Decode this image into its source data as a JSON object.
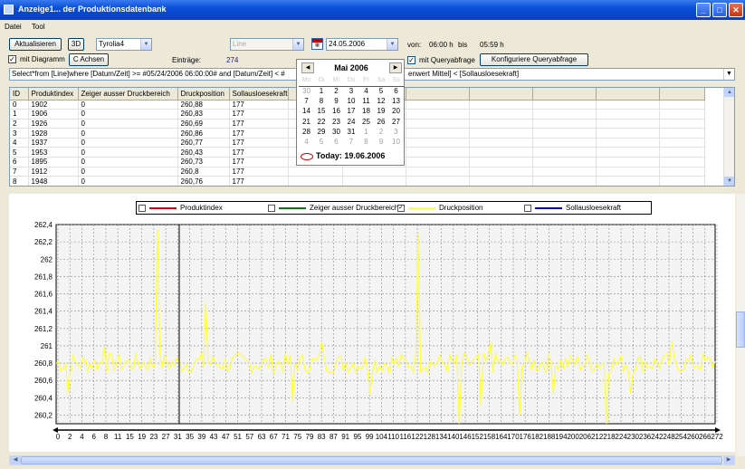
{
  "window": {
    "title": "Anzeige1... der Produktionsdatenbank",
    "min": "_",
    "max": "□",
    "close": "✕"
  },
  "menu": [
    "Datei",
    "Tool"
  ],
  "toolbar": {
    "refresh": "Aktualisieren",
    "btn3d": "3D",
    "device": "Tyrolia4",
    "line": "Line",
    "date": "24.05.2006",
    "from_label": "von:",
    "from_time": "06:00 h",
    "to_label": "bis",
    "to_time": "05:59 h",
    "with_chart": "mit Diagramm",
    "c_axes": "C Achsen",
    "entries_label": "Einträge:",
    "entries_value": "274",
    "with_query": "mit Queryabfrage",
    "configure_query": "Konfiguriere Queryabfrage"
  },
  "query": {
    "left": "Select*from [Line]where  [Datum/Zeit] >= #05/24/2006 06:00:00# and [Datum/Zeit] < #",
    "right": "enwert Mittel] < [Sollausloesekraft]"
  },
  "calendar": {
    "month": "Mai 2006",
    "weekdays": [
      "Mo",
      "Di",
      "Mi",
      "Do",
      "Fr",
      "Sa",
      "So"
    ],
    "weeks": [
      [
        "30",
        "1",
        "2",
        "3",
        "4",
        "5",
        "6"
      ],
      [
        "7",
        "8",
        "9",
        "10",
        "11",
        "12",
        "13"
      ],
      [
        "14",
        "15",
        "16",
        "17",
        "18",
        "19",
        "20"
      ],
      [
        "21",
        "22",
        "23",
        "24",
        "25",
        "26",
        "27"
      ],
      [
        "28",
        "29",
        "30",
        "31",
        "1",
        "2",
        "3"
      ],
      [
        "4",
        "5",
        "6",
        "7",
        "8",
        "9",
        "10"
      ]
    ],
    "today": "Today: 19.06.2006"
  },
  "grid": {
    "columns": [
      "ID",
      "Produktindex",
      "Zeiger ausser Druckbereich",
      "Druckposition",
      "Sollausloesekraft"
    ],
    "rows": [
      [
        "0",
        "1902",
        "0",
        "260,88",
        "177"
      ],
      [
        "1",
        "1906",
        "0",
        "260,83",
        "177"
      ],
      [
        "2",
        "1926",
        "0",
        "260,69",
        "177"
      ],
      [
        "3",
        "1928",
        "0",
        "260,86",
        "177"
      ],
      [
        "4",
        "1937",
        "0",
        "260,77",
        "177"
      ],
      [
        "5",
        "1953",
        "0",
        "260,43",
        "177"
      ],
      [
        "6",
        "1895",
        "0",
        "260,73",
        "177"
      ],
      [
        "7",
        "1912",
        "0",
        "260,8",
        "177"
      ],
      [
        "8",
        "1948",
        "0",
        "260,76",
        "177"
      ]
    ]
  },
  "legend": [
    {
      "label": "Produktindex",
      "color": "#e00000",
      "checked": false
    },
    {
      "label": "Zeiger ausser Druckbereich",
      "color": "#008000",
      "checked": false
    },
    {
      "label": "Druckposition",
      "color": "#ffff40",
      "checked": true
    },
    {
      "label": "Sollausloesekraft",
      "color": "#0000c0",
      "checked": false
    }
  ],
  "chart_data": {
    "type": "line",
    "ylim": [
      260.1,
      262.4
    ],
    "yticks": [
      "262,4",
      "262,2",
      "262",
      "261,8",
      "261,6",
      "261,4",
      "261,2",
      "261",
      "260,8",
      "260,6",
      "260,4",
      "260,2"
    ],
    "xticks": [
      "0",
      "2",
      "4",
      "6",
      "8",
      "11",
      "15",
      "19",
      "23",
      "27",
      "31",
      "35",
      "39",
      "43",
      "47",
      "51",
      "57",
      "63",
      "67",
      "71",
      "75",
      "79",
      "83",
      "87",
      "91",
      "95",
      "99",
      "104",
      "110",
      "116",
      "122",
      "128",
      "134",
      "140",
      "146",
      "152",
      "158",
      "164",
      "170",
      "176",
      "182",
      "188",
      "194",
      "200",
      "206",
      "212",
      "218",
      "224",
      "230",
      "236",
      "242",
      "248",
      "254",
      "260",
      "266",
      "272"
    ],
    "x_count": 274,
    "cursor_x": 51,
    "series": [
      {
        "name": "Druckposition",
        "color": "#ffff40",
        "spikes": [
          {
            "i": 5,
            "v": 260.45
          },
          {
            "i": 42,
            "v": 262.35
          },
          {
            "i": 62,
            "v": 261.5
          },
          {
            "i": 150,
            "v": 262.3
          },
          {
            "i": 167,
            "v": 260.1
          },
          {
            "i": 176,
            "v": 260.3
          },
          {
            "i": 192,
            "v": 260.2
          },
          {
            "i": 228,
            "v": 260.1
          },
          {
            "i": 98,
            "v": 260.35
          },
          {
            "i": 130,
            "v": 260.45
          },
          {
            "i": 238,
            "v": 260.45
          },
          {
            "i": 110,
            "v": 261.05
          },
          {
            "i": 255,
            "v": 261.05
          },
          {
            "i": 20,
            "v": 261.0
          },
          {
            "i": 180,
            "v": 261.05
          },
          {
            "i": 206,
            "v": 260.45
          }
        ],
        "baseline": 260.8,
        "noise": 0.12
      }
    ]
  }
}
